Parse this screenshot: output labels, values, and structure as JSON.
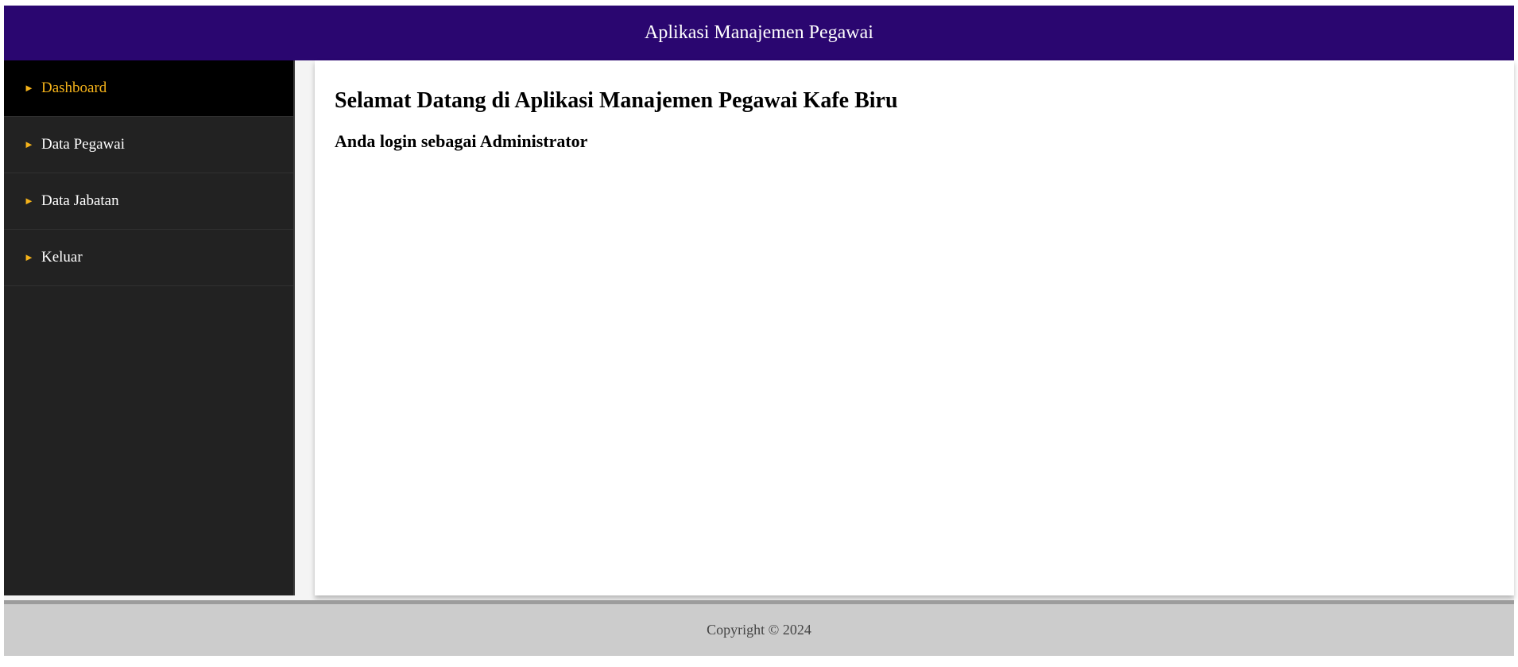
{
  "header": {
    "title": "Aplikasi Manajemen Pegawai"
  },
  "sidebar": {
    "items": [
      {
        "label": "Dashboard",
        "icon": "triangle-right-icon",
        "active": true
      },
      {
        "label": "Data Pegawai",
        "icon": "triangle-right-icon",
        "active": false
      },
      {
        "label": "Data Jabatan",
        "icon": "triangle-right-icon",
        "active": false
      },
      {
        "label": "Keluar",
        "icon": "triangle-right-icon",
        "active": false
      }
    ],
    "arrow_glyph": "►"
  },
  "main": {
    "welcome": "Selamat Datang di Aplikasi Manajemen Pegawai Kafe Biru",
    "role_text": "Anda login sebagai Administrator"
  },
  "footer": {
    "copyright": "Copyright © 2024"
  },
  "colors": {
    "header_bg": "#2a0670",
    "sidebar_bg": "#222222",
    "active_item_bg": "#000000",
    "accent": "#f5b31a",
    "footer_bg": "#cccccc"
  }
}
